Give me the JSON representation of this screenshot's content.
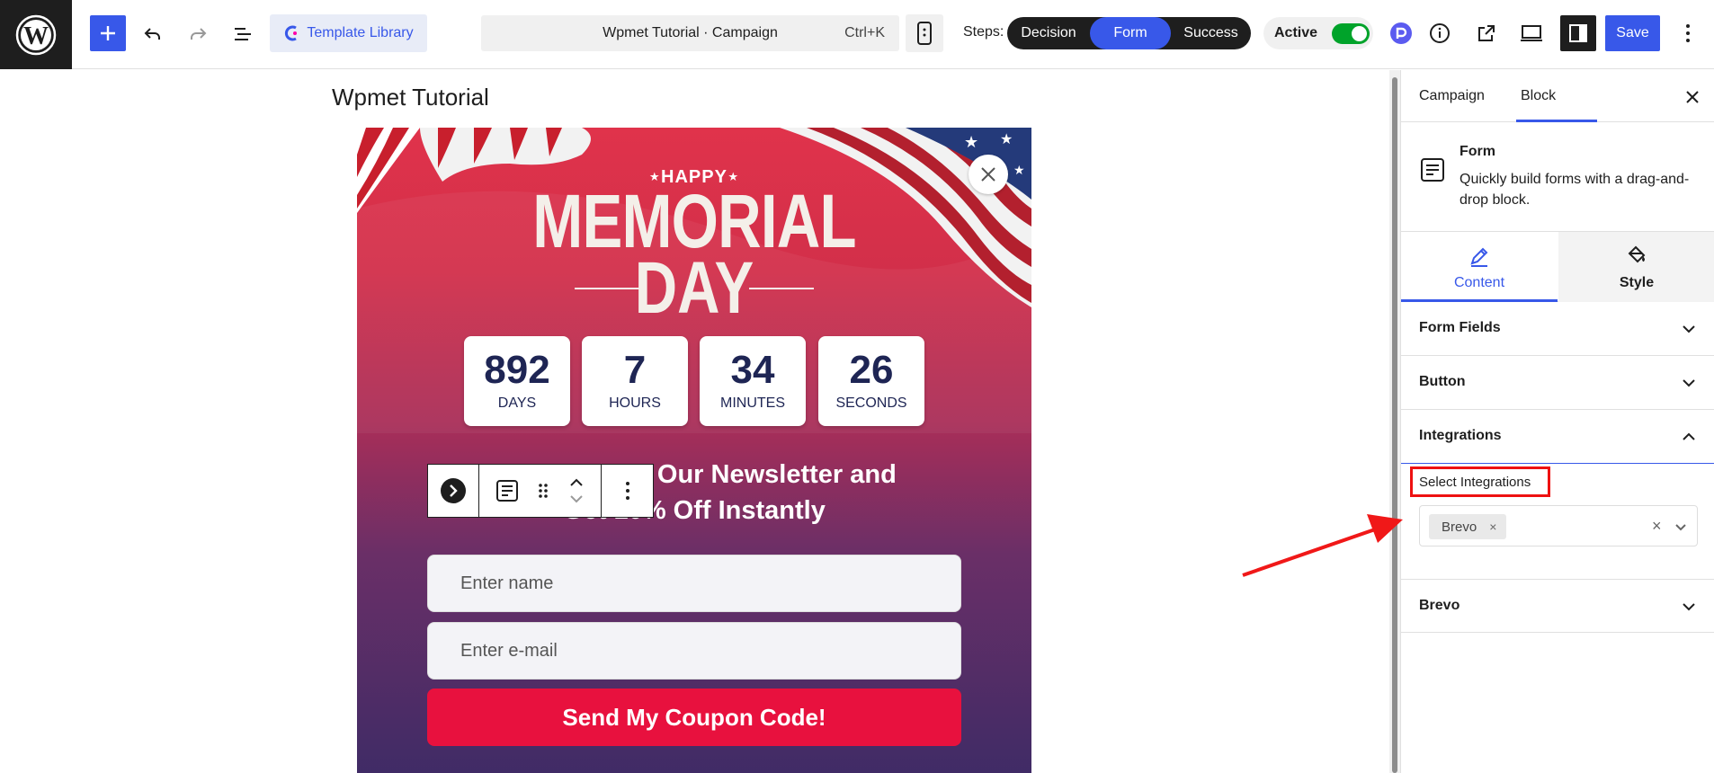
{
  "topbar": {
    "template_library_label": "Template Library",
    "command_title": "Wpmet Tutorial · Campaign",
    "command_shortcut": "Ctrl+K",
    "steps_label": "Steps:",
    "steps": [
      {
        "label": "Decision",
        "selected": false
      },
      {
        "label": "Form",
        "selected": true
      },
      {
        "label": "Success",
        "selected": false
      }
    ],
    "active_label": "Active",
    "active_on": true,
    "save_label": "Save"
  },
  "canvas": {
    "campaign_title": "Wpmet Tutorial",
    "popup": {
      "happy_text": "⋆HAPPY⋆",
      "memorial_text": "MEMORIAL",
      "day_text": "DAY",
      "countdown": [
        {
          "value": "892",
          "label": "DAYS"
        },
        {
          "value": "7",
          "label": "HOURS"
        },
        {
          "value": "34",
          "label": "MINUTES"
        },
        {
          "value": "26",
          "label": "SECONDS"
        }
      ],
      "headline_line1": "Subscribe to Our Newsletter and",
      "headline_line2": "Get 10% Off Instantly",
      "name_placeholder": "Enter name",
      "email_placeholder": "Enter e-mail",
      "submit_label": "Send My Coupon Code!"
    }
  },
  "sidebar": {
    "tabs": [
      {
        "label": "Campaign",
        "selected": false
      },
      {
        "label": "Block",
        "selected": true
      }
    ],
    "block": {
      "name": "Form",
      "description": "Quickly build forms with a drag-and-drop block."
    },
    "content_tabs": [
      {
        "label": "Content",
        "selected": true
      },
      {
        "label": "Style",
        "selected": false
      }
    ],
    "panels": {
      "form_fields": "Form Fields",
      "button": "Button",
      "integrations": "Integrations",
      "brevo": "Brevo"
    },
    "select_integrations_label": "Select Integrations",
    "selected_integrations": [
      "Brevo"
    ]
  },
  "colors": {
    "accent": "#3858e9",
    "highlight_box": "#ee1111",
    "toggle_on": "#00a32a",
    "submit_button": "#e8113e"
  },
  "icons": {
    "logo": "wordpress-icon",
    "add": "plus-icon",
    "undo": "undo-icon",
    "redo": "redo-icon",
    "outline": "list-view-icon",
    "mobile": "mobile-preview-icon",
    "info": "info-icon",
    "external": "external-link-icon",
    "desktop": "desktop-preview-icon",
    "sidebar": "sidebar-toggle-icon",
    "more": "more-vertical-icon"
  }
}
